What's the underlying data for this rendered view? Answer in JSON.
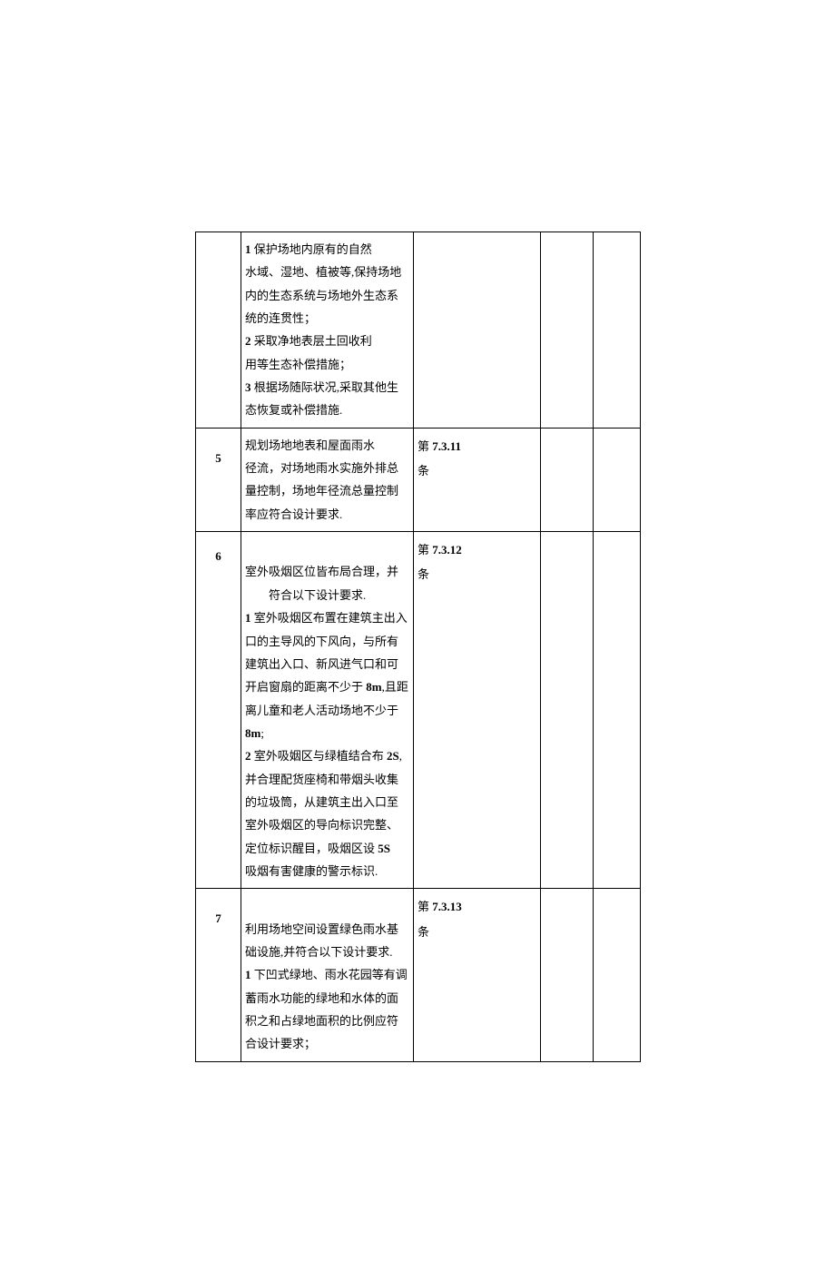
{
  "rows": [
    {
      "num": "",
      "desc": "1 保护场地内原有的自然\n水域、湿地、植被等,保持场地内的生态系统与场地外生态系统的连贯性；\n2 采取净地表层土回收利\n用等生态补偿措施；\n3 根据场随际状况,采取其他生态恢复或补偿措施.",
      "ref": ""
    },
    {
      "num": "5",
      "desc": "规划场地地表和屋面雨水\n径流，对场地雨水实施外排总量控制，场地年径流总量控制率应符合设计要求.",
      "ref": "第 7.3.11\n条"
    },
    {
      "num": "6",
      "desc": "\n室外吸烟区位皆布局合理，并\n　　符合以下设计要求.\n1 室外吸烟区布置在建筑主出入口的主导风的下风向，与所有建筑出入口、新风进气口和可开启窗扇的距离不少于 8m,且距离儿童和老人活动场地不少于 8m;\n2 室外吸姻区与绿植结合布 2S,并合理配货座椅和带烟头收集的垃圾筒，从建筑主出入口至室外吸烟区的导向标识完整、定位标识醒目，吸烟区设 5S\n吸烟有害健康的警示标识.",
      "ref": "第 7.3.12\n条"
    },
    {
      "num": "7",
      "desc": "\n利用场地空间设置绿色雨水基础设施,并符合以下设计要求.\n1 下凹式绿地、雨水花园等有调蓄雨水功能的绿地和水体的面积之和占绿地面积的比例应符合设计要求；",
      "ref": "第 7.3.13\n条"
    }
  ]
}
